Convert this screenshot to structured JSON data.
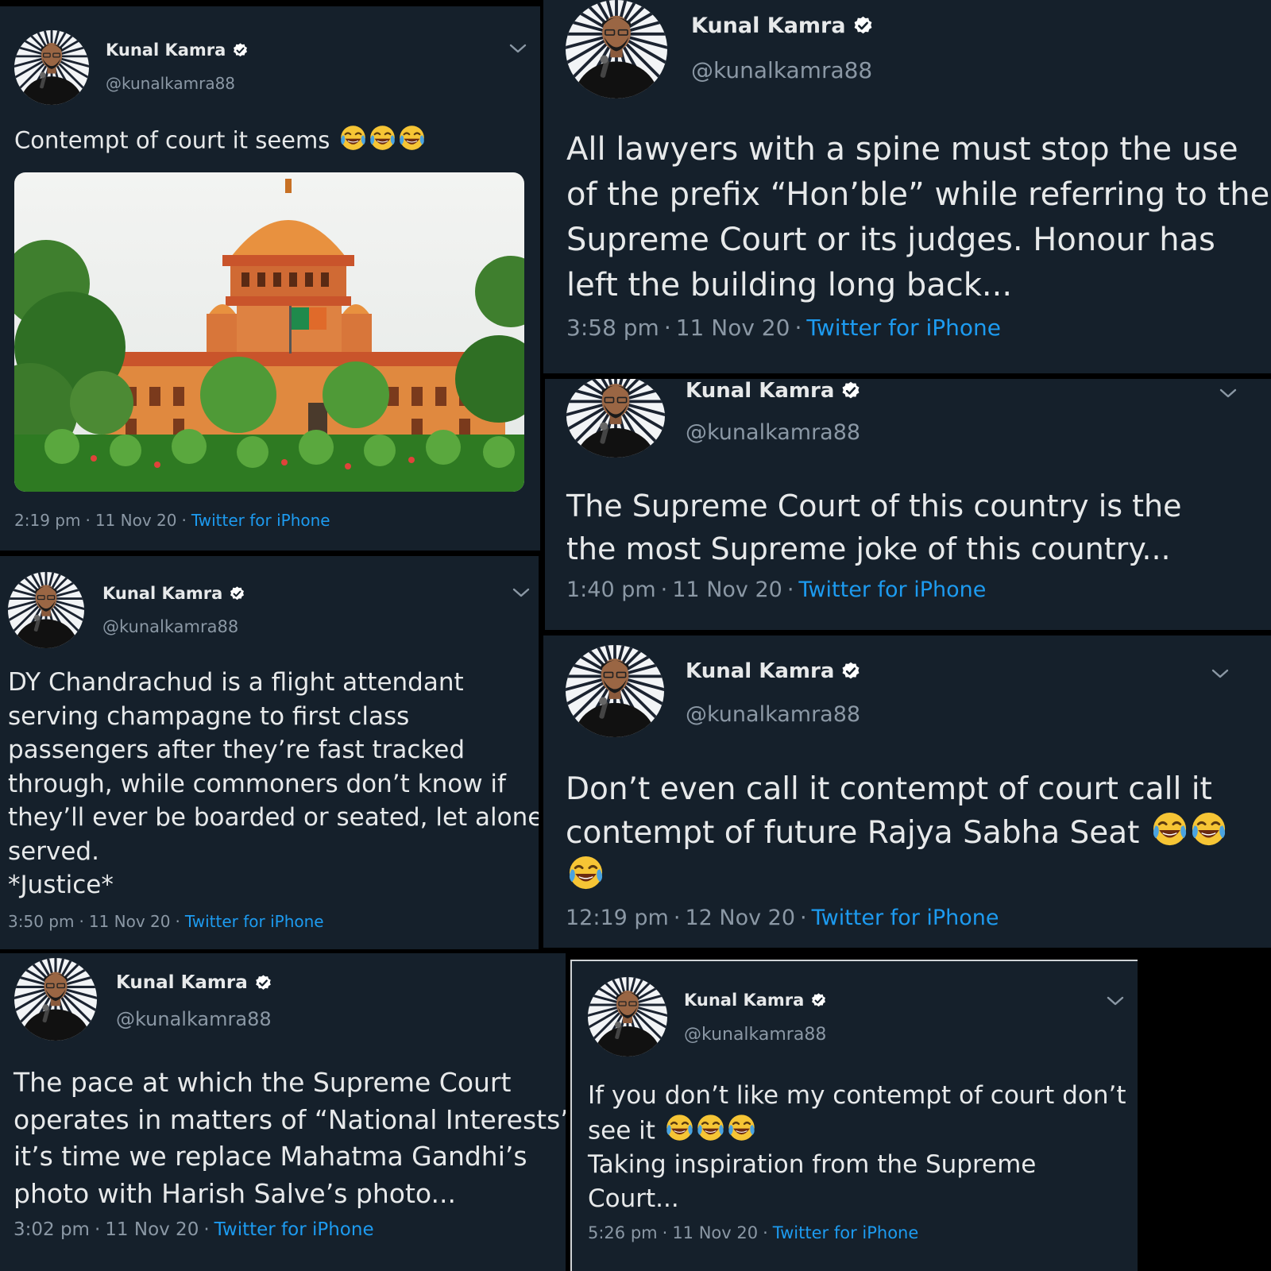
{
  "author": {
    "name": "Kunal Kamra",
    "handle": "@kunalkamra88"
  },
  "colors": {
    "tweet_bg": "#15202b",
    "text": "#e7e9ea",
    "muted": "#8b98a5",
    "link": "#1d9bf0",
    "verified": "#ffffff"
  },
  "tweets": [
    {
      "id": "t1",
      "lines": [
        "Contempt of court it seems"
      ],
      "emoji_count": 3,
      "time": "2:19 pm",
      "date": "11 Nov 20",
      "source": "Twitter for iPhone",
      "has_image": true
    },
    {
      "id": "t2",
      "lines": [
        "All lawyers with a spine must stop the use",
        "of the prefix “Hon’ble” while referring to the",
        "Supreme Court or its judges. Honour has",
        "left the building long back..."
      ],
      "time": "3:58 pm",
      "date": "11 Nov 20",
      "source": "Twitter for iPhone"
    },
    {
      "id": "t3",
      "lines": [
        "The Supreme Court of this country is the",
        "the most Supreme joke of this country..."
      ],
      "time": "1:40 pm",
      "date": "11 Nov 20",
      "source": "Twitter for iPhone"
    },
    {
      "id": "t4",
      "lines": [
        "DY Chandrachud is a flight attendant",
        "serving champagne to first class",
        "passengers after they’re fast tracked",
        "through, while commoners don’t know if",
        "they’ll ever be boarded or seated, let alone",
        "served.",
        "*Justice*"
      ],
      "time": "3:50 pm",
      "date": "11 Nov 20",
      "source": "Twitter for iPhone"
    },
    {
      "id": "t5",
      "lines": [
        "Don’t even call it contempt of court call it",
        "contempt of future Rajya Sabha  Seat"
      ],
      "time": "12:19 pm",
      "date": "12 Nov 20",
      "source": "Twitter for iPhone"
    },
    {
      "id": "t6",
      "lines": [
        "The pace at which the Supreme Court",
        "operates in matters of “National Interests”",
        "it’s time we replace Mahatma Gandhi’s",
        "photo with Harish Salve’s photo..."
      ],
      "time": "3:02 pm",
      "date": "11 Nov 20",
      "source": "Twitter for iPhone"
    },
    {
      "id": "t7",
      "lines": [
        "If you don’t like my contempt of court don’t",
        "see it",
        "Taking inspiration from the Supreme",
        "Court..."
      ],
      "time": "5:26 pm",
      "date": "11 Nov 20",
      "source": "Twitter for iPhone"
    }
  ],
  "dot": "·",
  "icons": {
    "verified": "verified-badge-icon",
    "chevron": "chevron-down-icon",
    "emoji": "face-with-tears-of-joy-emoji"
  }
}
